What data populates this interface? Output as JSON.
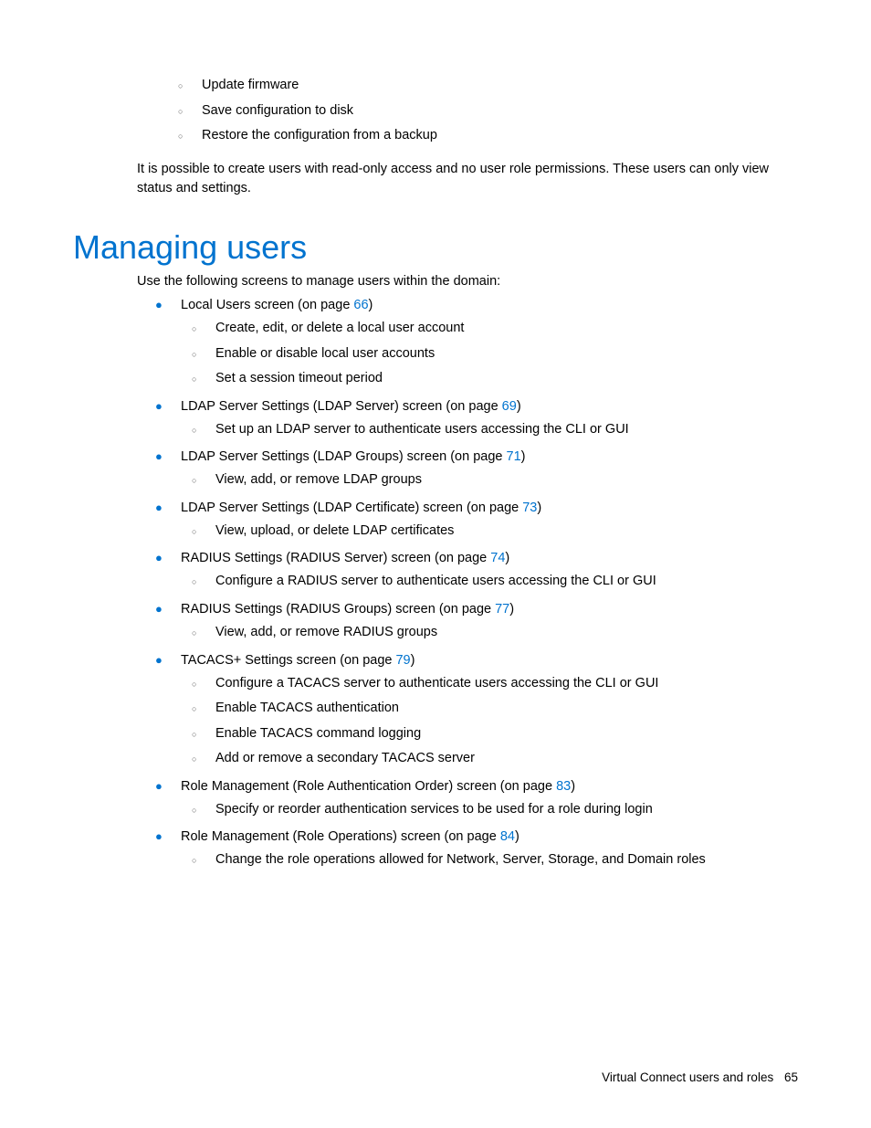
{
  "top_list": {
    "item1": "Update firmware",
    "item2": "Save configuration to disk",
    "item3": "Restore the configuration from a backup"
  },
  "paragraph1": "It is possible to create users with read-only access and no user role permissions. These users can only view status and settings.",
  "heading": "Managing users",
  "intro": "Use the following screens to manage users within the domain:",
  "items": [
    {
      "text_before": "Local Users screen (on page ",
      "link": "66",
      "text_after": ")",
      "subs": [
        "Create, edit, or delete a local user account",
        "Enable or disable local user accounts",
        "Set a session timeout period"
      ]
    },
    {
      "text_before": "LDAP Server Settings (LDAP Server) screen (on page ",
      "link": "69",
      "text_after": ")",
      "subs": [
        "Set up an LDAP server to authenticate users accessing the CLI or GUI"
      ]
    },
    {
      "text_before": "LDAP Server Settings (LDAP Groups) screen (on page ",
      "link": "71",
      "text_after": ")",
      "subs": [
        "View, add, or remove LDAP groups"
      ]
    },
    {
      "text_before": "LDAP Server Settings (LDAP Certificate) screen (on page ",
      "link": "73",
      "text_after": ")",
      "subs": [
        "View, upload, or delete LDAP certificates"
      ]
    },
    {
      "text_before": "RADIUS Settings (RADIUS Server) screen (on page ",
      "link": "74",
      "text_after": ")",
      "subs": [
        "Configure a RADIUS server to authenticate users accessing the CLI or GUI"
      ]
    },
    {
      "text_before": "RADIUS Settings (RADIUS Groups) screen (on page ",
      "link": "77",
      "text_after": ")",
      "subs": [
        "View, add, or remove RADIUS groups"
      ]
    },
    {
      "text_before": "TACACS+ Settings screen (on page ",
      "link": "79",
      "text_after": ")",
      "subs": [
        "Configure a TACACS server to authenticate users accessing the CLI or GUI",
        "Enable TACACS authentication",
        "Enable TACACS command logging",
        "Add or remove a secondary TACACS server"
      ]
    },
    {
      "text_before": "Role Management (Role Authentication Order) screen (on page ",
      "link": "83",
      "text_after": ")",
      "subs": [
        "Specify or reorder authentication services to be used for a role during login"
      ]
    },
    {
      "text_before": "Role Management (Role Operations) screen (on page ",
      "link": "84",
      "text_after": ")",
      "subs": [
        "Change the role operations allowed for Network, Server, Storage, and Domain roles"
      ]
    }
  ],
  "footer": {
    "text": "Virtual Connect users and roles",
    "page": "65"
  }
}
